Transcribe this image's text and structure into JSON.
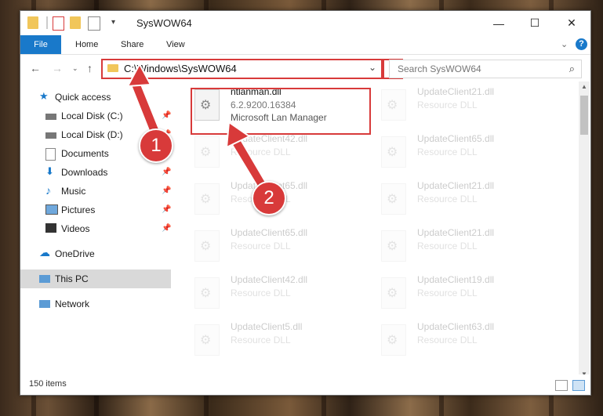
{
  "window": {
    "title": "SysWOW64"
  },
  "ribbon": {
    "file": "File",
    "home": "Home",
    "share": "Share",
    "view": "View",
    "help": "?"
  },
  "address": {
    "path": "C:\\Windows\\SysWOW64"
  },
  "search": {
    "placeholder": "Search SysWOW64"
  },
  "sidebar": {
    "items": [
      {
        "label": "Quick access"
      },
      {
        "label": "Local Disk (C:)"
      },
      {
        "label": "Local Disk (D:)"
      },
      {
        "label": "Documents"
      },
      {
        "label": "Downloads"
      },
      {
        "label": "Music"
      },
      {
        "label": "Pictures"
      },
      {
        "label": "Videos"
      },
      {
        "label": "OneDrive"
      },
      {
        "label": "This PC"
      },
      {
        "label": "Network"
      }
    ]
  },
  "files": [
    {
      "name": "ntlanman.dll",
      "version": "6.2.9200.16384",
      "desc": "Microsoft Lan Manager"
    },
    {
      "name": "UpdateClient21.dll",
      "desc": "Resource DLL"
    },
    {
      "name": "UpdateClient42.dll",
      "desc": "Resource DLL"
    },
    {
      "name": "UpdateClient65.dll",
      "desc": "Resource DLL"
    },
    {
      "name": "UpdateClient65.dll",
      "desc": "Resource DLL"
    },
    {
      "name": "UpdateClient21.dll",
      "desc": "Resource DLL"
    },
    {
      "name": "UpdateClient65.dll",
      "desc": "Resource DLL"
    },
    {
      "name": "UpdateClient21.dll",
      "desc": "Resource DLL"
    },
    {
      "name": "UpdateClient42.dll",
      "desc": "Resource DLL"
    },
    {
      "name": "UpdateClient19.dll",
      "desc": "Resource DLL"
    },
    {
      "name": "UpdateClient5.dll",
      "desc": "Resource DLL"
    },
    {
      "name": "UpdateClient63.dll",
      "desc": "Resource DLL"
    }
  ],
  "status": {
    "count": "150 items"
  },
  "callouts": {
    "one": "1",
    "two": "2"
  },
  "colors": {
    "accent": "#1979ca",
    "highlight": "#d83a3a"
  }
}
